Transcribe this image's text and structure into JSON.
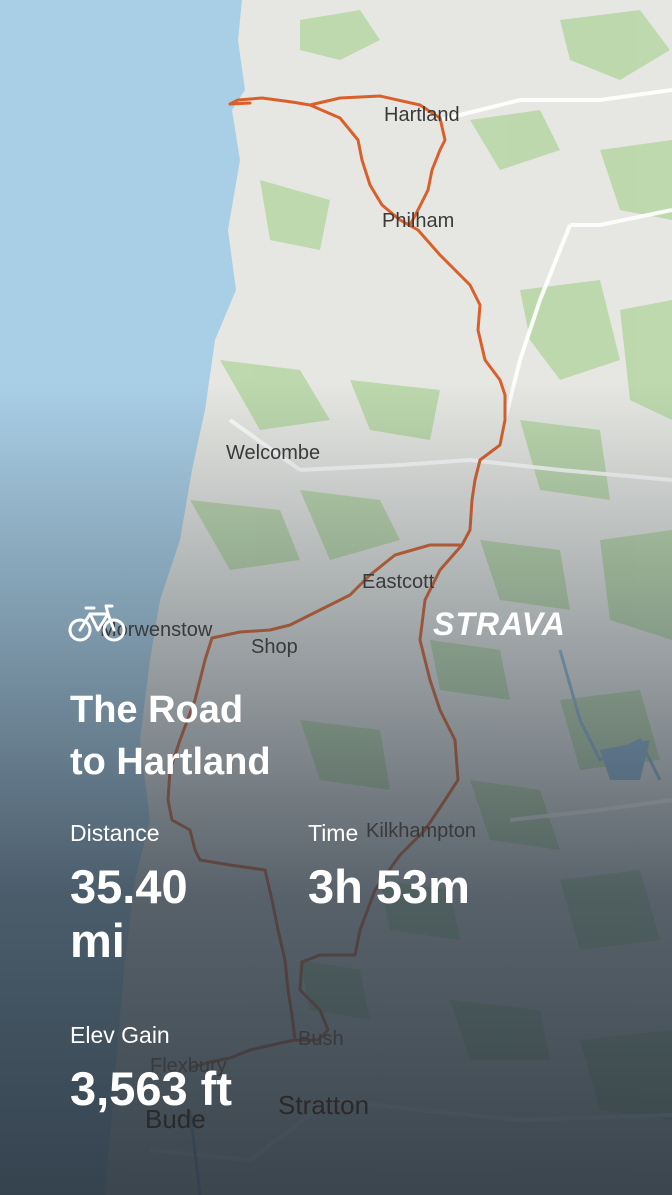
{
  "map": {
    "places": {
      "hartland": "Hartland",
      "philham": "Philham",
      "welcombe": "Welcombe",
      "eastcott": "Eastcott",
      "morwenstow": "Morwenstow",
      "shop": "Shop",
      "kilkhampton": "Kilkhampton",
      "bush": "Bush",
      "flexbury": "Flexbury",
      "stratton": "Stratton",
      "bude": "Bude"
    },
    "route_color": "#d9602a",
    "sea_color": "#a9cfe6"
  },
  "activity": {
    "sport_icon": "bicycle-icon",
    "brand": "STRAVA",
    "title_line1": "The Road",
    "title_line2": "to Hartland",
    "distance_label": "Distance",
    "distance_value_line1": "35.40",
    "distance_value_line2": "mi",
    "time_label": "Time",
    "time_value": "3h 53m",
    "elev_label": "Elev Gain",
    "elev_value": "3,563 ft"
  }
}
